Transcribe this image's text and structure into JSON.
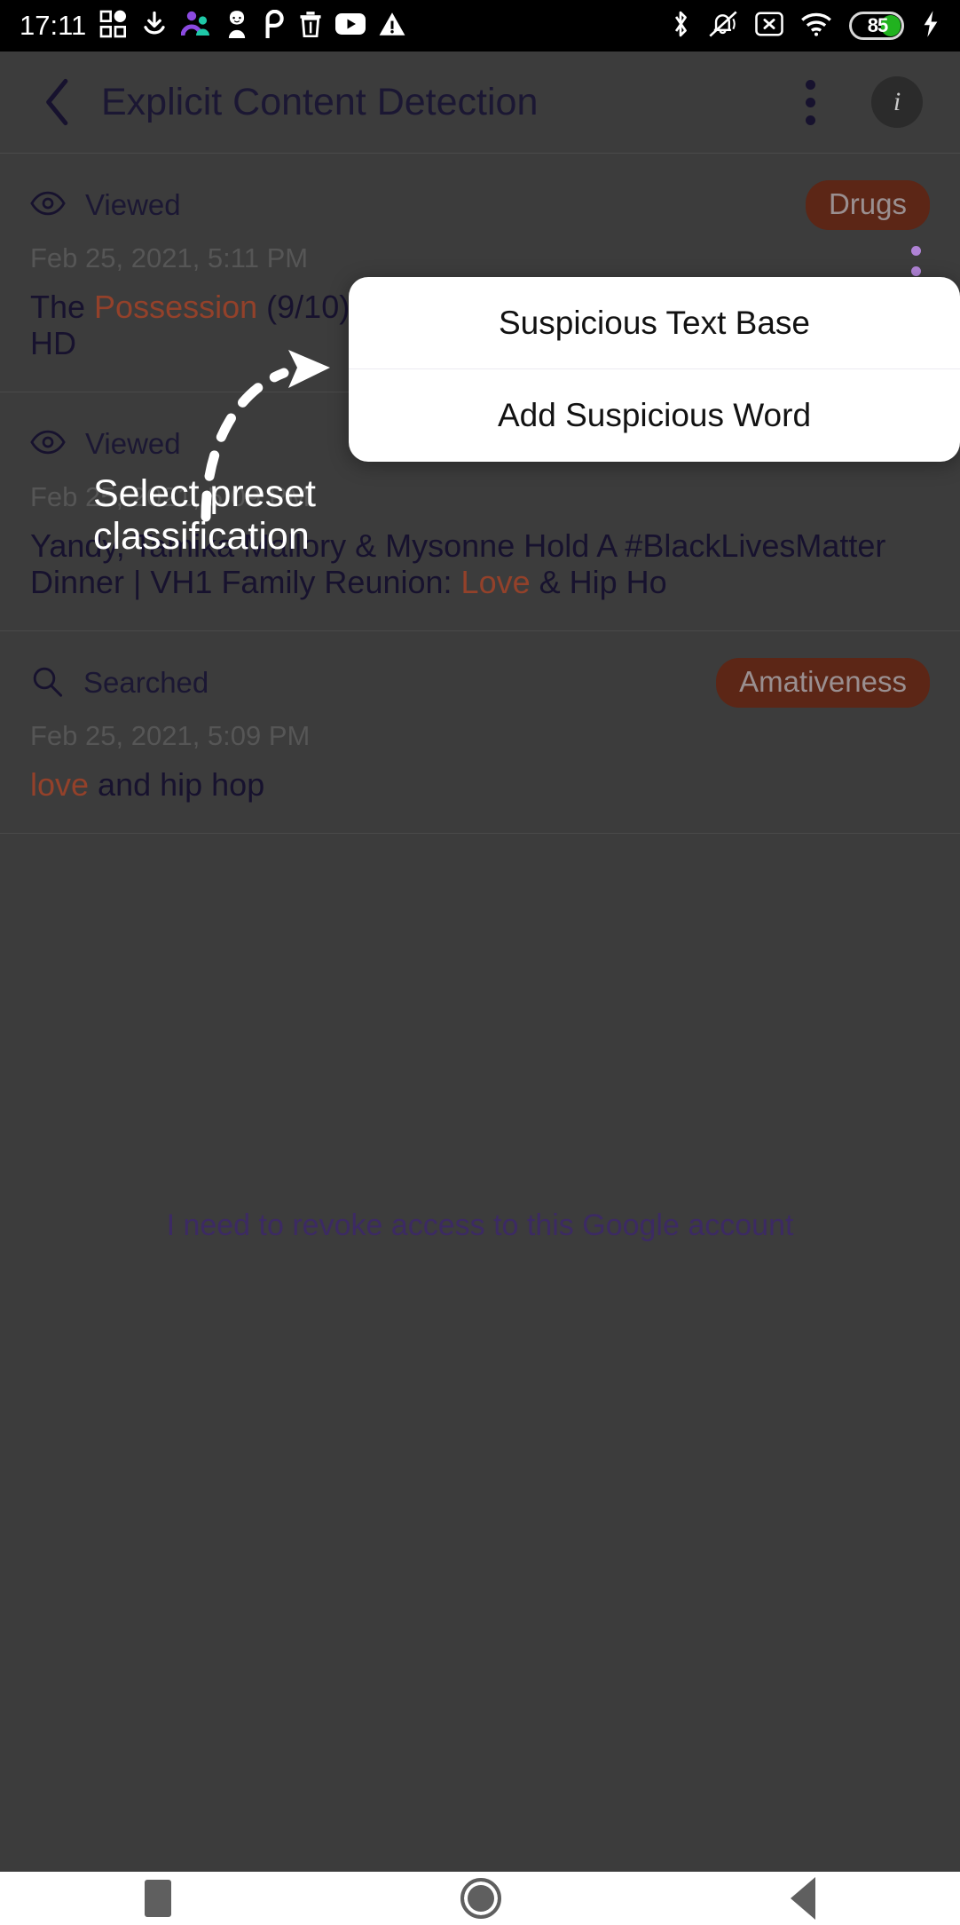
{
  "status_bar": {
    "time": "17:11",
    "left_icons": [
      "apps-grid-icon",
      "download-icon",
      "family-link-icon",
      "contact-avatar-icon",
      "pinterest-icon",
      "trash-icon",
      "youtube-icon",
      "warning-triangle-icon"
    ],
    "right_icons": [
      "bluetooth-icon",
      "mute-bell-icon",
      "no-sim-icon",
      "wifi-icon"
    ],
    "battery_level": "85",
    "battery_color": "#21b21f",
    "charging": true
  },
  "app_bar": {
    "back_label": "Back",
    "title": "Explicit Content Detection",
    "overflow_label": "More options",
    "info_label": "i"
  },
  "list": {
    "items": [
      {
        "kind": "Viewed",
        "kind_icon": "eye-icon",
        "badge": "Drugs",
        "date": "Feb 25, 2021, 5:11 PM",
        "text_parts": [
          {
            "t": "The ",
            "hl": false
          },
          {
            "t": "Possession",
            "hl": true
          },
          {
            "t": " (9/10) Movie CLIP - The Exorcism (2012) HD",
            "hl": false
          }
        ]
      },
      {
        "kind": "Viewed",
        "kind_icon": "eye-icon",
        "badge": "",
        "date": "Feb 25, 2021, 5:09 PM",
        "text_parts": [
          {
            "t": "Yandy, Tamika Mallory & Mysonne Hold A #BlackLivesMatter Dinner | VH1 Family Reunion: ",
            "hl": false
          },
          {
            "t": "Love",
            "hl": true
          },
          {
            "t": " & Hip Ho",
            "hl": false
          }
        ]
      },
      {
        "kind": "Searched",
        "kind_icon": "search-icon",
        "badge": "Amativeness",
        "date": "Feb 25, 2021, 5:09 PM",
        "text_parts": [
          {
            "t": "love",
            "hl": true
          },
          {
            "t": " and hip hop",
            "hl": false
          }
        ]
      }
    ],
    "revoke_link": "I need to revoke access to this Google account",
    "badge_bg": "#5c2616",
    "highlight_color": "#93412a"
  },
  "popup_menu": {
    "items": [
      {
        "label": "Suspicious Text Base"
      },
      {
        "label": "Add Suspicious Word"
      }
    ]
  },
  "annotation": {
    "text_line1": "Select preset",
    "text_line2": "classification",
    "arrow": "dashed-curved-arrow-icon",
    "color": "#ffffff"
  },
  "nav_bar": {
    "recent_label": "Recents",
    "home_label": "Home",
    "back_label": "Back"
  }
}
